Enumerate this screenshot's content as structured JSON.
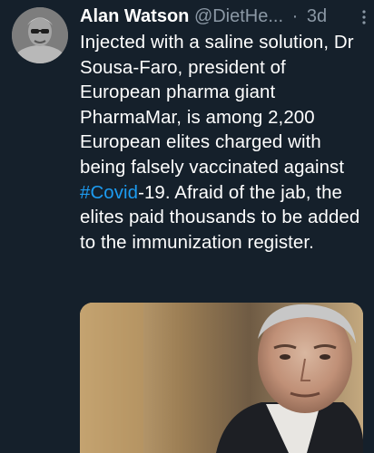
{
  "tweet": {
    "author_name": "Alan Watson",
    "handle": "@DietHe...",
    "separator": "·",
    "time": "3d",
    "text_part1": "Injected with a saline solution, Dr Sousa-Faro, president of European pharma giant PharmaMar, is among 2,200 European elites charged with being falsely vaccinated against ",
    "hashtag": "#Covid",
    "text_part2": "-19. Afraid of the jab, the elites paid thousands to be added to the immunization register."
  },
  "icons": {
    "more": "more-vertical-icon",
    "avatar": "avatar"
  },
  "colors": {
    "background": "#15202b",
    "text": "#ffffff",
    "muted": "#8b98a5",
    "link": "#1d9bf0"
  }
}
